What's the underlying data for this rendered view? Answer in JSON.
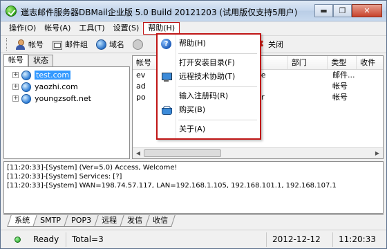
{
  "window": {
    "title": "邋志邮件服务器DBMail企业版 5.0 Build 20121203 (试用版仅支持5用户)",
    "minimize_glyph": "▬",
    "restore_glyph": "❐",
    "close_glyph": "✕"
  },
  "menu": {
    "items": [
      "操作(O)",
      "帐号(A)",
      "工具(T)",
      "设置(S)",
      "帮助(H)"
    ],
    "open": "帮助(H)"
  },
  "toolbar": {
    "buttons": [
      "帐号",
      "邮件组",
      "域名",
      "关闭"
    ]
  },
  "left_tabs": [
    "帐号",
    "状态"
  ],
  "tree": {
    "domains": [
      "test.com",
      "yaozhi.com",
      "youngzsoft.net"
    ],
    "selected": "test.com"
  },
  "list": {
    "headers": [
      "帐号",
      "部门",
      "类型",
      "收件"
    ],
    "rows": [
      {
        "account": "ev",
        "tail": "me",
        "type": "邮件..."
      },
      {
        "account": "ad",
        "tail": "",
        "type": "帐号"
      },
      {
        "account": "po",
        "tail": "ter",
        "type": "帐号"
      }
    ]
  },
  "help_menu": {
    "items": [
      "帮助(H)",
      "打开安装目录(F)",
      "远程技术协助(T)",
      "输入注册码(R)",
      "购买(B)",
      "关于(A)"
    ]
  },
  "log": {
    "lines": [
      "[11:20:33]-[System] (Ver=5.0) Access, Welcome!",
      "[11:20:33]-[System] Services: [?]",
      "[11:20:33]-[System] WAN=198.74.57.117, LAN=192.168.1.105, 192.168.101.1, 192.168.107.1"
    ]
  },
  "bottom_tabs": [
    "系统",
    "SMTP",
    "POP3",
    "远程",
    "发信",
    "收信"
  ],
  "status": {
    "ready": "Ready",
    "total": "Total=3",
    "date": "2012-12-12",
    "time": "11:20:33"
  },
  "colors": {
    "menu_highlight": "#c01515",
    "selection": "#3399ff"
  }
}
